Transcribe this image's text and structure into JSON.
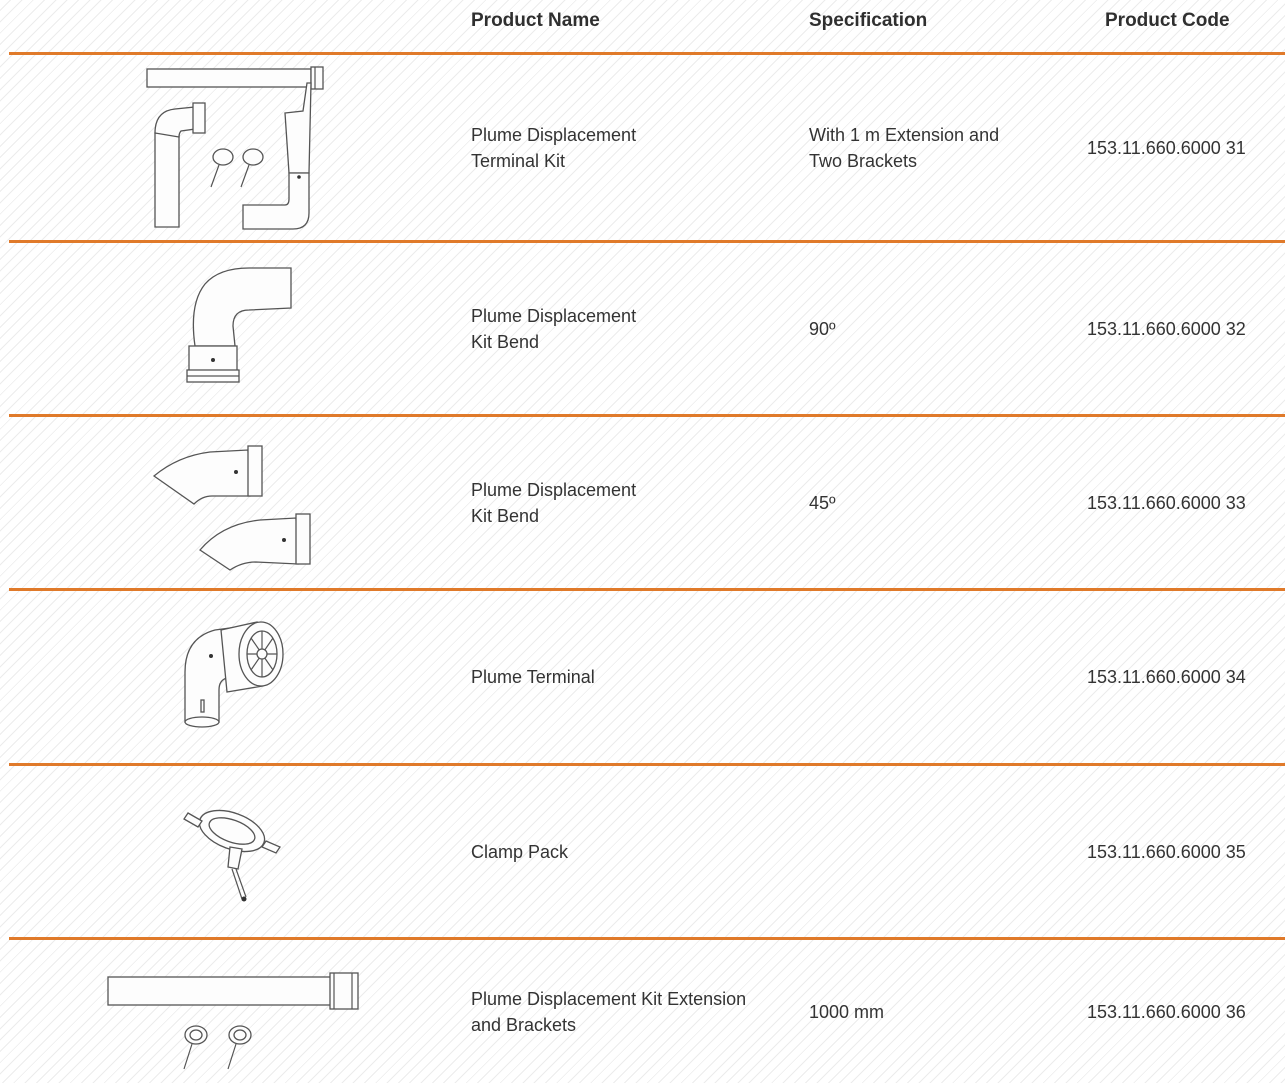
{
  "columns": {
    "name": "Product Name",
    "spec": "Specification",
    "code": "Product Code"
  },
  "rows": [
    {
      "image_icon": "terminal-kit-icon",
      "name": "Plume Displacement Terminal Kit",
      "name_lines": [
        "Plume Displacement",
        "Terminal Kit"
      ],
      "spec_lines": [
        "With 1 m Extension and",
        "Two Brackets"
      ],
      "code": "153.11.660.6000 31"
    },
    {
      "image_icon": "bend-90-icon",
      "name_lines": [
        "Plume Displacement",
        "Kit Bend"
      ],
      "spec_lines": [
        "90º"
      ],
      "code": "153.11.660.6000 32"
    },
    {
      "image_icon": "bend-45-icon",
      "name_lines": [
        "Plume Displacement",
        "Kit Bend"
      ],
      "spec_lines": [
        "45º"
      ],
      "code": "153.11.660.6000 33"
    },
    {
      "image_icon": "plume-terminal-icon",
      "name_lines": [
        "Plume Terminal"
      ],
      "spec_lines": [],
      "code": "153.11.660.6000 34"
    },
    {
      "image_icon": "clamp-icon",
      "name_lines": [
        "Clamp Pack"
      ],
      "spec_lines": [],
      "code": "153.11.660.6000 35"
    },
    {
      "image_icon": "extension-brackets-icon",
      "name_lines": [
        "Plume Displacement Kit Extension",
        "and Brackets"
      ],
      "spec_lines": [
        "1000 mm"
      ],
      "code": "153.11.660.6000 36"
    }
  ],
  "colors": {
    "divider": "#e07a2a",
    "text": "#333333"
  }
}
